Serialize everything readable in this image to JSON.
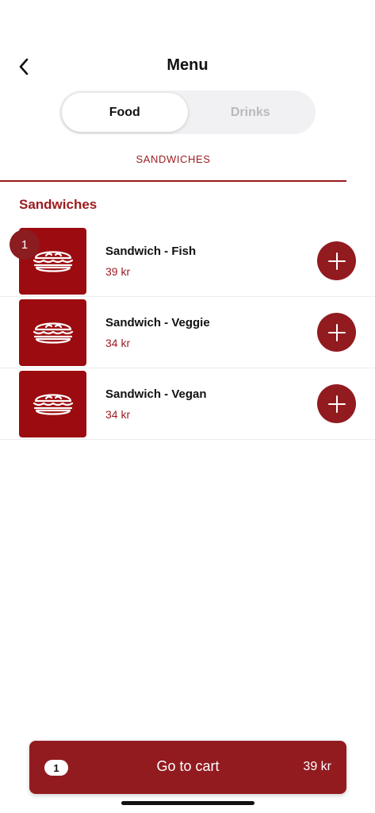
{
  "header": {
    "title": "Menu",
    "back_icon": "chevron-left-icon"
  },
  "segments": [
    {
      "label": "Food",
      "active": true
    },
    {
      "label": "Drinks",
      "active": false
    }
  ],
  "category_tab": {
    "label": "SANDWICHES"
  },
  "section": {
    "title": "Sandwiches"
  },
  "items": [
    {
      "name": "Sandwich - Fish",
      "price": "39 kr",
      "badge": "1",
      "icon": "sandwich-icon"
    },
    {
      "name": "Sandwich - Veggie",
      "price": "34 kr",
      "badge": null,
      "icon": "sandwich-icon"
    },
    {
      "name": "Sandwich - Vegan",
      "price": "34 kr",
      "badge": null,
      "icon": "sandwich-icon"
    }
  ],
  "cart": {
    "count": "1",
    "label": "Go to cart",
    "total": "39 kr"
  },
  "colors": {
    "accent": "#921b20",
    "thumb": "#9b0b0f"
  }
}
